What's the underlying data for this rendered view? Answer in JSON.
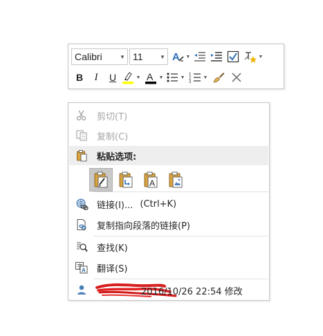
{
  "mini_toolbar": {
    "font_name": "Calibri",
    "font_size": "11",
    "bold_label": "B",
    "italic_label": "I",
    "underline_label": "U",
    "font_color_label": "A",
    "highlight_color": "#ffff00",
    "font_color": "#000000"
  },
  "context_menu": {
    "items": [
      {
        "label": "剪切(T)",
        "icon": "scissors-icon",
        "enabled": false
      },
      {
        "label": "复制(C)",
        "icon": "copy-icon",
        "enabled": false
      },
      {
        "label": "粘贴选项:",
        "icon": "clipboard-icon"
      },
      {
        "label": "链接(I)...",
        "shortcut": "(Ctrl+K)",
        "icon": "link-icon"
      },
      {
        "label": "复制指向段落的链接(P)",
        "icon": "copy-link-icon"
      },
      {
        "label": "查找(K)",
        "icon": "find-icon"
      },
      {
        "label": "翻译(S)",
        "icon": "translate-icon"
      }
    ],
    "paste_options": [
      {
        "icon": "paste-keep-formatting-icon",
        "selected": true
      },
      {
        "icon": "paste-merge-formatting-icon",
        "selected": false
      },
      {
        "icon": "paste-text-only-icon",
        "selected": false
      },
      {
        "icon": "paste-picture-icon",
        "selected": false
      }
    ],
    "modified_text": "2016/10/26 22:54 修改"
  }
}
